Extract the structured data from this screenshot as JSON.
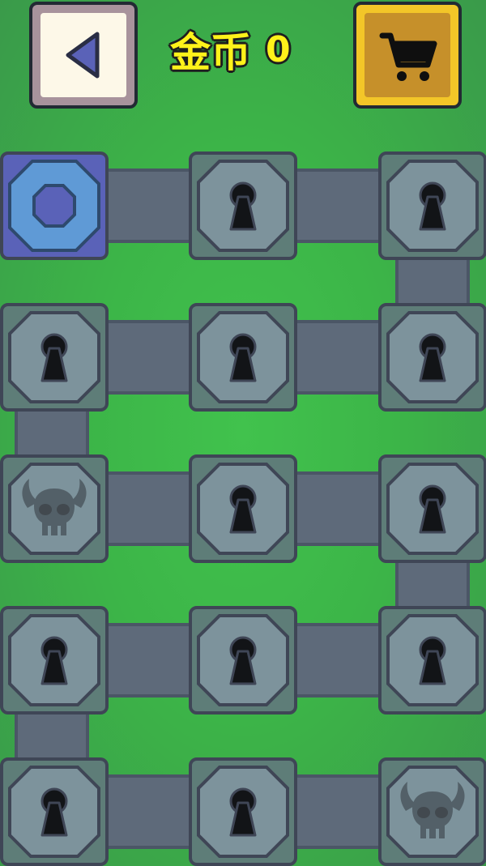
{
  "header": {
    "coins_label": "金币",
    "coins_value": "0"
  },
  "colors": {
    "background": "#41c24d",
    "locked_tile": "#5e7d78",
    "current_tile": "#5a62b8",
    "coin_text": "#fff21a",
    "shop_button": "#f3c628"
  },
  "grid": [
    [
      "current",
      "locked",
      "locked"
    ],
    [
      "locked",
      "locked",
      "locked"
    ],
    [
      "boss",
      "locked",
      "locked"
    ],
    [
      "locked",
      "locked",
      "locked"
    ],
    [
      "locked",
      "locked",
      "boss"
    ]
  ]
}
